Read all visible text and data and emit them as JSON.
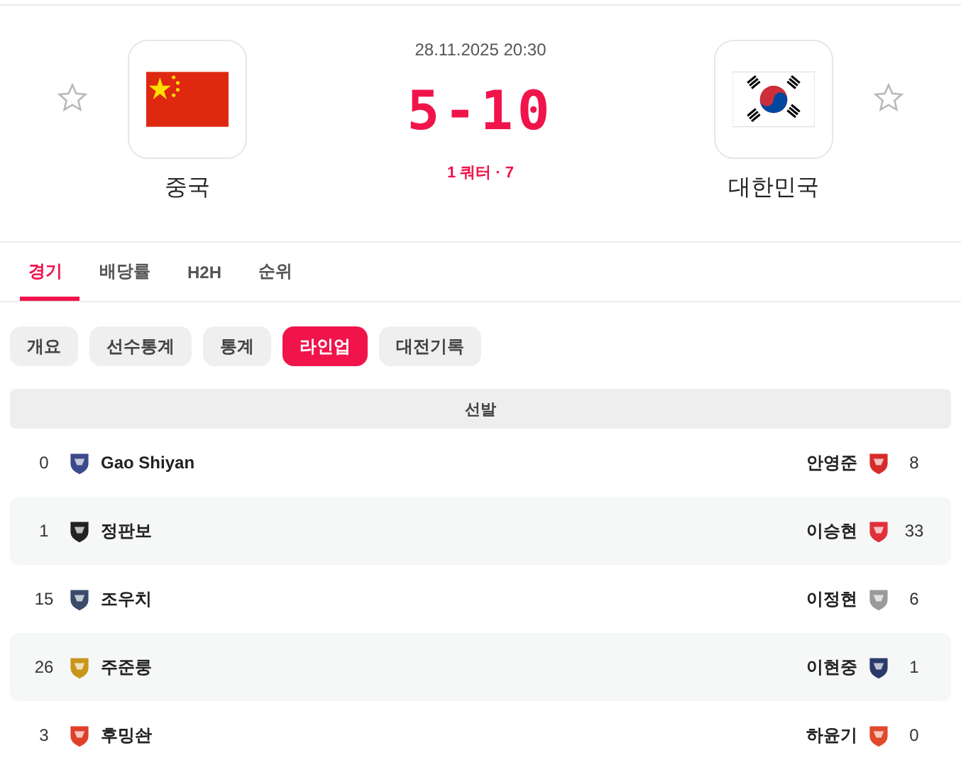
{
  "match": {
    "datetime": "28.11.2025 20:30",
    "score": "5-10",
    "period": "1 쿼터 · 7",
    "home": {
      "name": "중국",
      "kind": "cn",
      "favorite": false
    },
    "away": {
      "name": "대한민국",
      "kind": "kr",
      "favorite": false
    }
  },
  "tabs": [
    {
      "label": "경기",
      "selected": true
    },
    {
      "label": "배당률",
      "selected": false
    },
    {
      "label": "H2H",
      "selected": false
    },
    {
      "label": "순위",
      "selected": false
    }
  ],
  "subtabs": [
    {
      "label": "개요",
      "selected": false
    },
    {
      "label": "선수통계",
      "selected": false
    },
    {
      "label": "통계",
      "selected": false
    },
    {
      "label": "라인업",
      "selected": true
    },
    {
      "label": "대전기록",
      "selected": false
    }
  ],
  "section": "선발",
  "rows": [
    {
      "home": {
        "number": "0",
        "name": "Gao Shiyan",
        "color": "#3b4a8c"
      },
      "away": {
        "number": "8",
        "name": "안영준",
        "color": "#d62b2b"
      }
    },
    {
      "home": {
        "number": "1",
        "name": "정판보",
        "color": "#222222"
      },
      "away": {
        "number": "33",
        "name": "이승현",
        "color": "#e0303a"
      }
    },
    {
      "home": {
        "number": "15",
        "name": "조우치",
        "color": "#3a4a6a"
      },
      "away": {
        "number": "6",
        "name": "이정현",
        "color": "#9a9a9a"
      }
    },
    {
      "home": {
        "number": "26",
        "name": "주준룽",
        "color": "#c9961a"
      },
      "away": {
        "number": "1",
        "name": "이현중",
        "color": "#2b3a6b"
      }
    },
    {
      "home": {
        "number": "3",
        "name": "후밍솬",
        "color": "#e0402a"
      },
      "away": {
        "number": "0",
        "name": "하윤기",
        "color": "#e04a2a"
      }
    }
  ]
}
